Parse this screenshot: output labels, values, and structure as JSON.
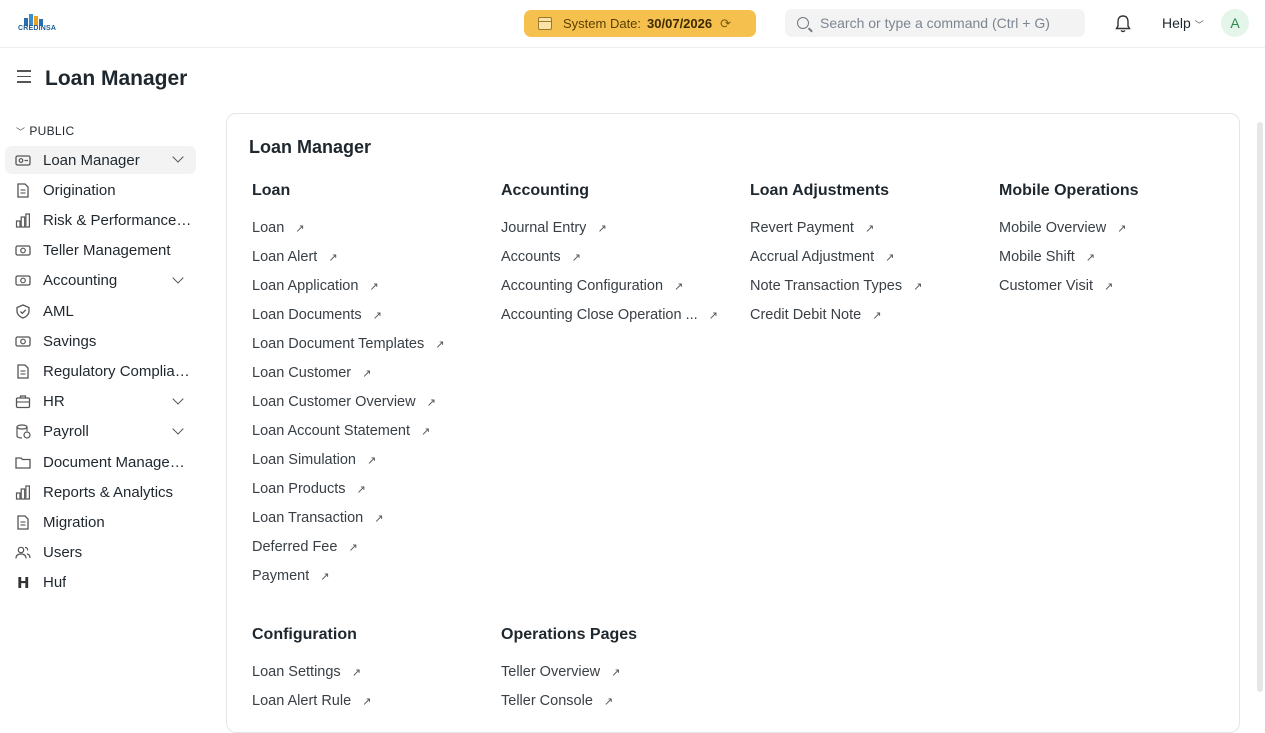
{
  "app": {
    "logo_text": "CREDINSA"
  },
  "topbar": {
    "system_date_label": "System Date:",
    "system_date_value": "30/07/2026",
    "search_placeholder": "Search or type a command (Ctrl + G)",
    "help_label": "Help",
    "avatar_initial": "A"
  },
  "page": {
    "title": "Loan Manager"
  },
  "sidebar": {
    "section": "PUBLIC",
    "items": [
      {
        "label": "Loan Manager",
        "icon": "loan-icon",
        "expandable": true
      },
      {
        "label": "Origination",
        "icon": "document-icon",
        "expandable": false
      },
      {
        "label": "Risk & Performance ...",
        "icon": "bar-chart-icon",
        "expandable": false
      },
      {
        "label": "Teller Management",
        "icon": "money-icon",
        "expandable": false
      },
      {
        "label": "Accounting",
        "icon": "money-icon",
        "expandable": true
      },
      {
        "label": "AML",
        "icon": "shield-icon",
        "expandable": false
      },
      {
        "label": "Savings",
        "icon": "money-icon",
        "expandable": false
      },
      {
        "label": "Regulatory Complian...",
        "icon": "document-icon",
        "expandable": false
      },
      {
        "label": "HR",
        "icon": "briefcase-icon",
        "expandable": true
      },
      {
        "label": "Payroll",
        "icon": "database-icon",
        "expandable": true
      },
      {
        "label": "Document Managem...",
        "icon": "folder-icon",
        "expandable": false
      },
      {
        "label": "Reports & Analytics",
        "icon": "bar-chart-icon",
        "expandable": false
      },
      {
        "label": "Migration",
        "icon": "document-icon",
        "expandable": false
      },
      {
        "label": "Users",
        "icon": "users-icon",
        "expandable": false
      },
      {
        "label": "Huf",
        "icon": "letter-h-icon",
        "expandable": false
      }
    ]
  },
  "card": {
    "title": "Loan Manager",
    "columns": [
      {
        "title": "Loan",
        "links": [
          "Loan",
          "Loan Alert",
          "Loan Application",
          "Loan Documents",
          "Loan Document Templates",
          "Loan Customer",
          "Loan Customer Overview",
          "Loan Account Statement",
          "Loan Simulation",
          "Loan Products",
          "Loan Transaction",
          "Deferred Fee",
          "Payment"
        ]
      },
      {
        "title": "Accounting",
        "links": [
          "Journal Entry",
          "Accounts",
          "Accounting Configuration",
          "Accounting Close Operation ..."
        ]
      },
      {
        "title": "Loan Adjustments",
        "links": [
          "Revert Payment",
          "Accrual Adjustment",
          "Note Transaction Types",
          "Credit Debit Note"
        ]
      },
      {
        "title": "Mobile Operations",
        "links": [
          "Mobile Overview",
          "Mobile Shift",
          "Customer Visit"
        ]
      },
      {
        "title": "Configuration",
        "links": [
          "Loan Settings",
          "Loan Alert Rule"
        ]
      },
      {
        "title": "Operations Pages",
        "links": [
          "Teller Overview",
          "Teller Console"
        ]
      }
    ]
  },
  "colors": {
    "system_date_bg": "#f5c04e",
    "accent": "#1f272e"
  }
}
